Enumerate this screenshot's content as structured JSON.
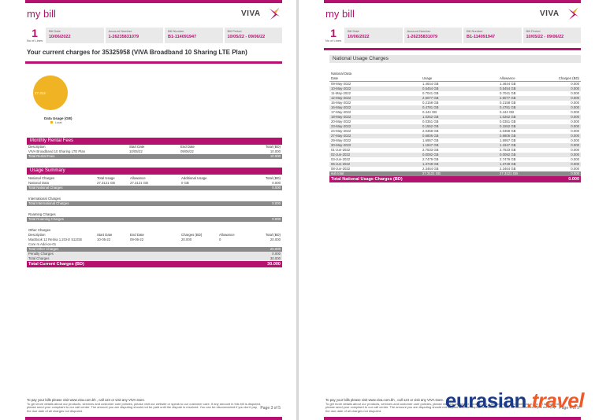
{
  "brand": {
    "my": "my",
    "bill": "bill",
    "logo_text": "VIVA",
    "accent_color": "#b5116f"
  },
  "header": {
    "no_of_lines_value": "1",
    "no_of_lines_label": "No of Lines",
    "bill_date_label": "Bill Date",
    "bill_date": "10/06/2022",
    "account_number_label": "Account Number",
    "account_number": "1-26235831079",
    "bill_number_label": "Bill Number",
    "bill_number": "B1-114091947",
    "bill_period_label": "Bill Period",
    "bill_period_left": "10/05/22 - 09/06/22",
    "bill_period_right": "10/05/22 - 09/06/22"
  },
  "summary": {
    "title": "Your current charges for  35325958 (VIVA Broadband 10 Sharing LTE Plan)",
    "chart_data": {
      "type": "pie",
      "title": "Data Usage (GB)",
      "slices": [
        {
          "label": "Local",
          "value": 27.3121,
          "color": "#f0b323"
        }
      ],
      "slice_label": "27.312"
    }
  },
  "monthly_rental": {
    "title": "Monthly Rental Fees",
    "columns": [
      "Description",
      "Start Date",
      "End Date",
      "Total (BD)"
    ],
    "rows": [
      [
        "VIVA Broadband 10 Sharing LTE Plan",
        "10/05/22",
        "09/06/22",
        "10.000"
      ]
    ],
    "total_label": "Total Rental Fees",
    "total_value": "10.000"
  },
  "usage_summary": {
    "title": "Usage Summary",
    "national_header": [
      "National Charges",
      "Total Usage",
      "Allowance",
      "Additional Usage",
      "Total (BD)"
    ],
    "national_row": [
      "National Data",
      "27.3121 GB",
      "27.3121 GB",
      "0 GB",
      "0.000"
    ],
    "national_total_label": "Total National Charges",
    "national_total_value": "0.000",
    "international_label": "International Charges",
    "international_total_label": "Total International Charges",
    "international_total_value": "0.000",
    "roaming_label": "Roaming Charges",
    "roaming_total_label": "Total Roaming Charges",
    "roaming_total_value": "0.000",
    "other_label": "Other Charges",
    "other_columns": [
      "Description",
      "Start Date",
      "End Date",
      "Charges (BD)",
      "Allowance",
      "Total (BD)"
    ],
    "other_row": [
      "MacBook 12 Retina 1.2GHz 512GB",
      "10-05-22",
      "09-06-22",
      "20.000",
      "0",
      "20.000"
    ],
    "other_row_sub": "Core m Add-on-01",
    "other_total_label": "Total Other Charges",
    "other_total_value": "20.000",
    "penalty_label": "Penalty Charges",
    "penalty_value": "0.000",
    "total_charges_label": "Total Charges",
    "total_charges_value": "30.000",
    "current_total_label": "Total Current Charges (BD)",
    "current_total_value": "30.000"
  },
  "footer": {
    "line1": "To pay your bills please visit www.viva.com.bh , call 124 or visit any VIVA store.",
    "line2": "To get more details about our products, services and customer care policies, please visit our website or speak to our customer care. If any amount in this bill is disputed,",
    "line3": "please send your complaint to our call center. The amount you are disputing should not be paid until the dispute is resolved. You can be disconnected if you don't pay",
    "line4": "the due date of all charges not disputed.",
    "page_left": "Page 3 of 5",
    "page_right": "Page 4 of 5"
  },
  "national_usage": {
    "title": "National Usage Charges",
    "subtitle": "National Data",
    "columns": [
      "Date",
      "Usage",
      "Allowance",
      "Charges (BD)"
    ],
    "rows": [
      [
        "09-May-2022",
        "1.4644 GB",
        "1.4644 GB",
        "0.000"
      ],
      [
        "10-May-2022",
        "0.5454 GB",
        "0.5454 GB",
        "0.000"
      ],
      [
        "11-May-2022",
        "0.7041 GB",
        "0.7041 GB",
        "0.000"
      ],
      [
        "12-May-2022",
        "2.6077 GB",
        "2.6077 GB",
        "0.000"
      ],
      [
        "15-May-2022",
        "0.2158 GB",
        "0.2158 GB",
        "0.000"
      ],
      [
        "16-May-2022",
        "0.4781 GB",
        "0.4781 GB",
        "0.000"
      ],
      [
        "17-May-2022",
        "0.444 GB",
        "0.444 GB",
        "0.000"
      ],
      [
        "18-May-2022",
        "1.0262 GB",
        "1.0262 GB",
        "0.000"
      ],
      [
        "20-May-2022",
        "0.0351 GB",
        "0.0351 GB",
        "0.000"
      ],
      [
        "23-May-2022",
        "0.1552 GB",
        "0.1552 GB",
        "0.000"
      ],
      [
        "24-May-2022",
        "2.0358 GB",
        "2.0358 GB",
        "0.000"
      ],
      [
        "27-May-2022",
        "0.6806 GB",
        "0.6806 GB",
        "0.000"
      ],
      [
        "29-May-2022",
        "1.6957 GB",
        "1.6957 GB",
        "0.000"
      ],
      [
        "30-May-2022",
        "1.1947 GB",
        "1.1947 GB",
        "0.000"
      ],
      [
        "01-Jun-2022",
        "2.7533 GB",
        "2.7533 GB",
        "0.000"
      ],
      [
        "02-Jun-2022",
        "0.0092 GB",
        "0.0092 GB",
        "0.000"
      ],
      [
        "03-Jun-2022",
        "2.7479 GB",
        "2.7479 GB",
        "0.000"
      ],
      [
        "06-Jun-2022",
        "1.3749 GB",
        "1.3749 GB",
        "0.000"
      ],
      [
        "08-Jun-2022",
        "2.3464 GB",
        "2.3464 GB",
        "0.000"
      ]
    ],
    "subtotal": [
      "sub total",
      "27.3121 GB",
      "27.3121 GB",
      "0.000"
    ],
    "total_label": "Total National Usage Charges (BD)",
    "total_value": "0.000"
  },
  "watermark": {
    "part1": "eurasian",
    "dot": ".",
    "part2": "travel"
  }
}
